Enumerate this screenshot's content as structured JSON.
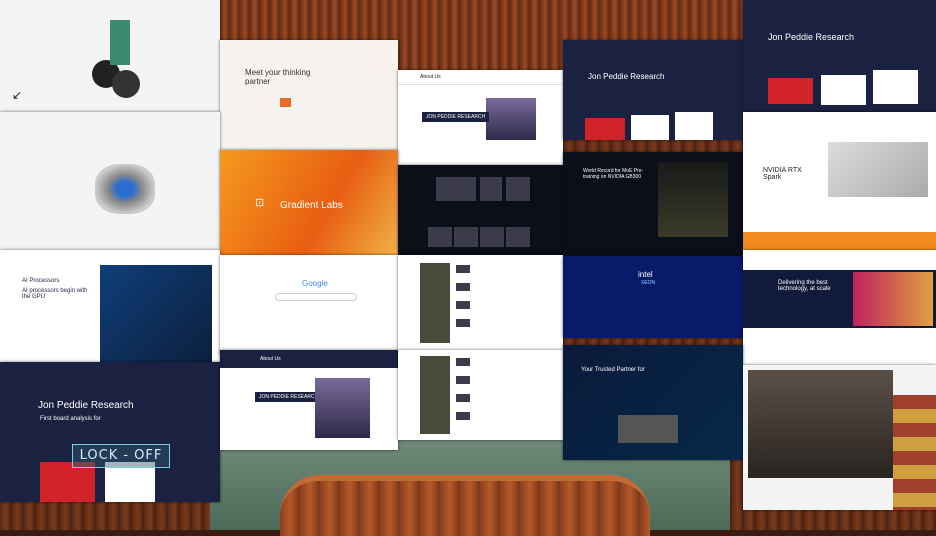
{
  "overlay": {
    "lock_label": "LOCK - OFF"
  },
  "panels": {
    "meet_partner": {
      "title": "Meet your thinking partner"
    },
    "gradient": {
      "title": "Gradient Labs"
    },
    "jpr_about": {
      "header": "About Us",
      "title": "JON PEDDIE RESEARCH"
    },
    "jpr_home": {
      "title": "Jon Peddie Research"
    },
    "jpr_home2": {
      "title": "Jon Peddie Research"
    },
    "mlperf": {
      "title": "World Record for MoE Pre-training on NVIDIA GB300"
    },
    "rtx": {
      "title": "NVIDIA RTX Spark"
    },
    "ai_processors": {
      "title": "AI Processors",
      "subtitle": "AI processors begin with the GPU"
    },
    "google": {
      "logo": "Google"
    },
    "intel": {
      "logo": "intel",
      "sub": "XEON"
    },
    "delivering": {
      "title": "Delivering the best technology, at scale"
    },
    "jpr_bottom": {
      "title": "Jon Peddie Research",
      "subtitle": "First board analysis for"
    },
    "jpr_about2": {
      "header": "About Us",
      "title": "JON PEDDIE RESEARCH"
    },
    "trusted": {
      "title": "Your Trusted Partner for"
    }
  },
  "colors": {
    "jpr_red": "#d2232a",
    "navy": "#1b2140",
    "orange": "#f28b1f"
  }
}
